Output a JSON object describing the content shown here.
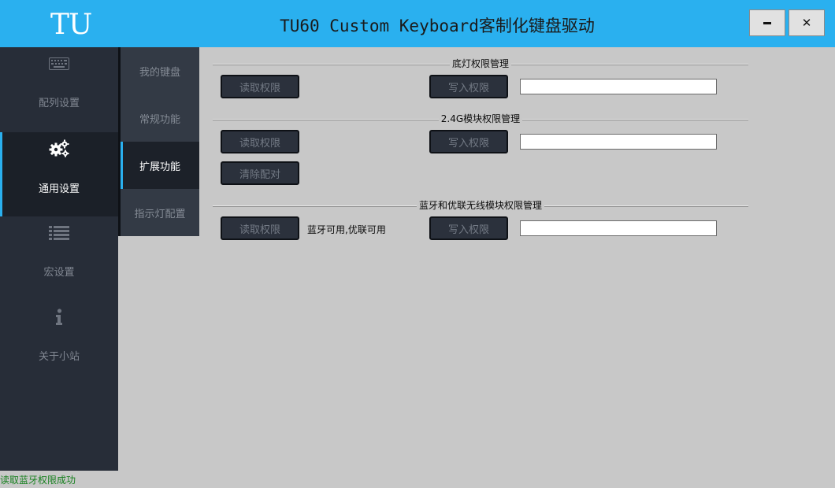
{
  "window": {
    "logo": "TU",
    "title": "TU60 Custom Keyboard客制化键盘驱动",
    "minimize_icon": "minimize-icon",
    "close_glyph": "✕"
  },
  "sidebar": {
    "items": [
      {
        "label": "配列设置",
        "icon": "keyboard-icon"
      },
      {
        "label": "通用设置",
        "icon": "gears-icon",
        "active": true
      },
      {
        "label": "宏设置",
        "icon": "list-icon"
      },
      {
        "label": "关于小站",
        "icon": "info-icon"
      }
    ]
  },
  "subnav": {
    "items": [
      {
        "label": "我的键盘"
      },
      {
        "label": "常规功能"
      },
      {
        "label": "扩展功能",
        "active": true
      },
      {
        "label": "指示灯配置"
      }
    ]
  },
  "sections": {
    "backlight": {
      "title": "底灯权限管理",
      "read_label": "读取权限",
      "write_label": "写入权限",
      "input_value": ""
    },
    "wireless24": {
      "title": "2.4G模块权限管理",
      "read_label": "读取权限",
      "write_label": "写入权限",
      "clear_label": "清除配对",
      "input_value": ""
    },
    "bluetooth": {
      "title": "蓝牙和优联无线模块权限管理",
      "read_label": "读取权限",
      "status_text": "蓝牙可用,优联可用",
      "write_label": "写入权限",
      "input_value": ""
    }
  },
  "statusbar": {
    "text": "读取蓝牙权限成功",
    "color": "#17801f"
  },
  "colors": {
    "accent": "#2ab0ef",
    "sidebar_bg": "#272d38",
    "content_bg": "#c8c8c8"
  }
}
